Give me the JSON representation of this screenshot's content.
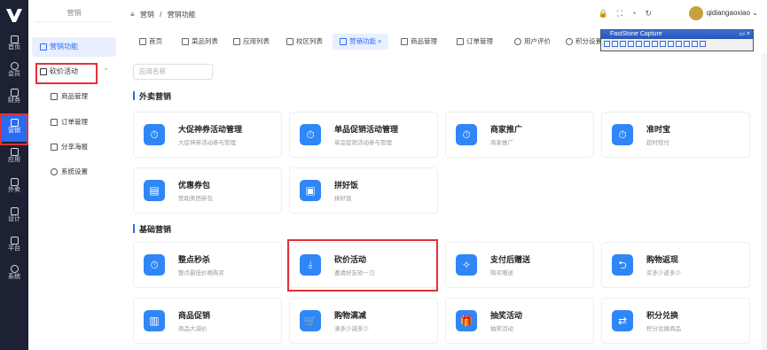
{
  "rail": {
    "items": [
      {
        "label": "首页",
        "icon": "home-icon"
      },
      {
        "label": "会员",
        "icon": "member-icon"
      },
      {
        "label": "财务",
        "icon": "finance-icon"
      },
      {
        "label": "营销",
        "icon": "marketing-icon"
      },
      {
        "label": "应用",
        "icon": "apps-icon"
      },
      {
        "label": "外卖",
        "icon": "takeout-icon"
      },
      {
        "label": "设计",
        "icon": "design-icon"
      },
      {
        "label": "平台",
        "icon": "platform-icon"
      },
      {
        "label": "系统",
        "icon": "system-icon"
      }
    ]
  },
  "sidebar": {
    "heading": "营销",
    "marketing_label": "营销功能",
    "bargain_label": "砍价活动",
    "subs": [
      "商品管理",
      "订单管理",
      "分享海报",
      "系统设置"
    ]
  },
  "header": {
    "breadcrumb_1": "营销",
    "breadcrumb_sep": "/",
    "breadcrumb_2": "营销功能",
    "username": "qidiangaoxiao"
  },
  "tabs": [
    "首页",
    "菜品列表",
    "应用列表",
    "校区列表",
    "营销功能",
    "商品管理",
    "订单管理",
    "用户评价",
    "积分设置"
  ],
  "tab_close": "×",
  "search": {
    "placeholder": "应用名称"
  },
  "sections": {
    "takeout": "外卖营销",
    "basic": "基础营销"
  },
  "takeout_cards": [
    {
      "title": "大促神券活动管理",
      "desc": "大促神券活动参与管理"
    },
    {
      "title": "单品促销活动管理",
      "desc": "单品促销活动参与管理"
    },
    {
      "title": "商家推广",
      "desc": "商家推广"
    },
    {
      "title": "准时宝",
      "desc": "超时赔付"
    },
    {
      "title": "优惠券包",
      "desc": "赞助美团券包"
    },
    {
      "title": "拼好饭",
      "desc": "拼好饭"
    }
  ],
  "basic_cards": [
    {
      "title": "整点秒杀",
      "desc": "整点最低价格购买"
    },
    {
      "title": "砍价活动",
      "desc": "邀请好友砍一刀"
    },
    {
      "title": "支付后赠送",
      "desc": "购买赠送"
    },
    {
      "title": "购物返现",
      "desc": "买多少返多少"
    },
    {
      "title": "商品促销",
      "desc": "商品大减价"
    },
    {
      "title": "购物满减",
      "desc": "满多少减多少"
    },
    {
      "title": "抽奖活动",
      "desc": "抽奖活动"
    },
    {
      "title": "积分兑换",
      "desc": "积分兑换商品"
    }
  ],
  "faststone": {
    "title": "FastStone Capture"
  },
  "colors": {
    "accent": "#2b6bf0",
    "highlight": "#e0313a",
    "rail": "#1c2233",
    "icon_bg": "#2f86f6"
  }
}
